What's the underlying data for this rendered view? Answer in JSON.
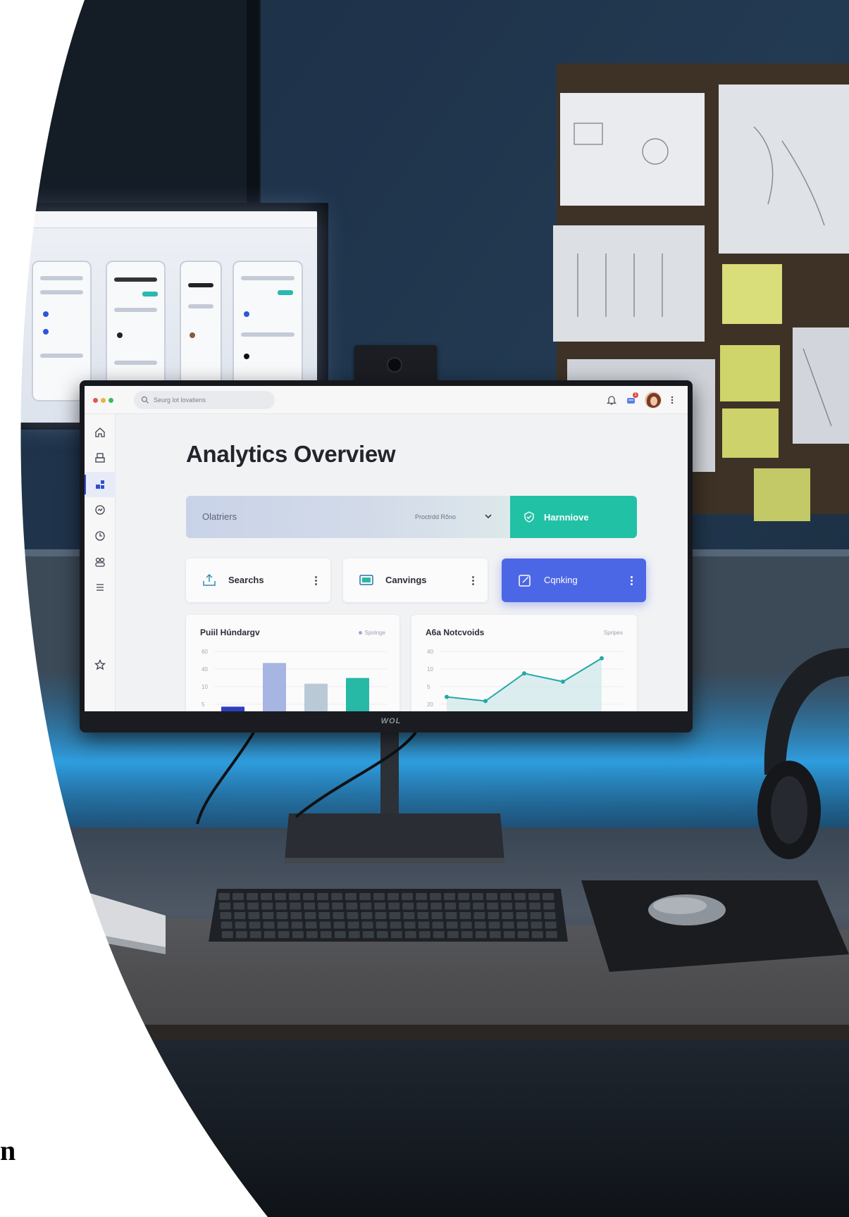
{
  "app": {
    "search": {
      "placeholder": "Seurg lot lovatiens"
    },
    "notifications": {
      "badge": "1"
    },
    "sidebar": {
      "items": [
        {
          "icon": "home-icon"
        },
        {
          "icon": "layers-icon"
        },
        {
          "icon": "dashboard-icon",
          "active": true
        },
        {
          "icon": "analytics-icon"
        },
        {
          "icon": "clock-icon"
        },
        {
          "icon": "users-icon"
        },
        {
          "icon": "list-icon"
        },
        {
          "icon": "star-icon"
        }
      ]
    },
    "page_title": "Analytics Overview",
    "filter": {
      "left_label": "Olatriers",
      "right_label": "Proctrdd Rõno",
      "action_label": "Harnniove"
    },
    "cards": [
      {
        "label": "Searchs",
        "icon": "upload-icon"
      },
      {
        "label": "Canvings",
        "icon": "monitor-icon"
      },
      {
        "label": "Cqnking",
        "icon": "edit-icon",
        "highlighted": true
      }
    ],
    "panels": {
      "bar": {
        "title": "Puiil Húndargv",
        "legend": "Spolnge"
      },
      "line": {
        "title": "A6a Notcvoids",
        "legend": "Spripes"
      }
    },
    "colors": {
      "accent_teal": "#21c1a5",
      "accent_blue": "#4c67e6",
      "nav_active": "#2f4fd1"
    }
  },
  "monitor_brand": "WOL",
  "corner_text": "n",
  "chart_data": [
    {
      "type": "bar",
      "title": "Puiil Húndargv",
      "categories": [
        "",
        "",
        "",
        ""
      ],
      "series": [
        {
          "name": "Spolnge",
          "values": [
            12,
            50,
            32,
            37
          ]
        }
      ],
      "yticks": [
        "60",
        "40",
        "10",
        "5"
      ],
      "colors": [
        "#2f3fbf",
        "#a7b5e3",
        "#b9cad6",
        "#27b9a6"
      ]
    },
    {
      "type": "line",
      "title": "A6a Notcvoids",
      "x": [
        1,
        2,
        3,
        4,
        5
      ],
      "series": [
        {
          "name": "Spripes",
          "values": [
            12,
            9,
            29,
            23,
            40
          ]
        }
      ],
      "yticks": [
        "40",
        "10",
        "5",
        "20"
      ],
      "colors": [
        "#24a9a6"
      ]
    }
  ]
}
